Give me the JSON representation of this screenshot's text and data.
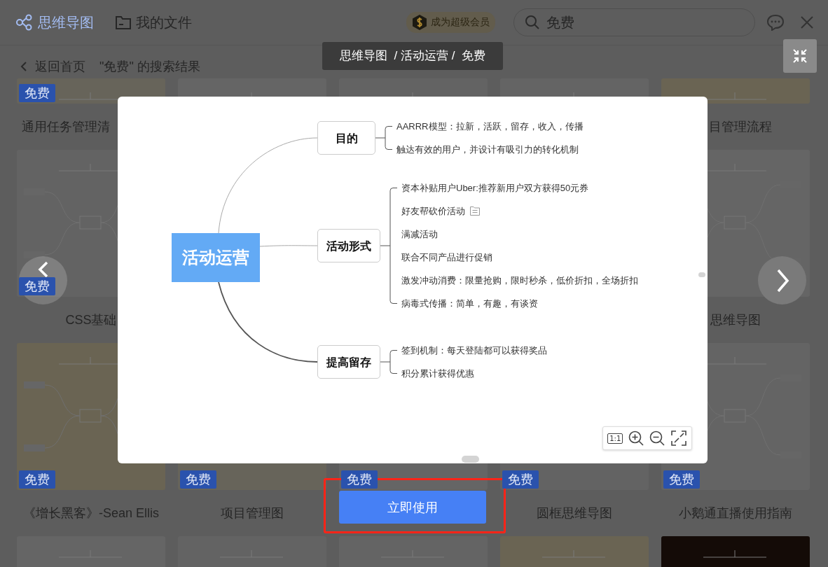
{
  "header": {
    "nav": [
      {
        "label": "思维导图",
        "selected": true
      },
      {
        "label": "我的文件",
        "selected": false
      }
    ],
    "vip": "成为超级会员",
    "search": {
      "value": "免费"
    }
  },
  "back": {
    "label": "返回首页",
    "results": "\"免费\" 的搜索结果"
  },
  "cards": [
    {
      "kind": "picture",
      "badge": "免费",
      "title": "通用任务管理清"
    },
    {
      "kind": "picture"
    },
    {
      "kind": "picture"
    },
    {
      "kind": "picture"
    },
    {
      "kind": "picture",
      "title": "目管理流程"
    },
    {
      "kind": "picture",
      "badge": "免费",
      "title": "CSS基础"
    },
    {
      "kind": "covered"
    },
    {
      "kind": "covered"
    },
    {
      "kind": "covered"
    },
    {
      "kind": "picture",
      "title": "思维导图"
    },
    {
      "kind": "picture",
      "badge": "免费",
      "title": "《增长黑客》-Sean Ellis"
    },
    {
      "kind": "picture",
      "badge": "免费",
      "title": "项目管理图"
    },
    {
      "kind": "picture",
      "badge": "免费"
    },
    {
      "kind": "picture",
      "badge": "免费",
      "title": "圆框思维导图"
    },
    {
      "kind": "picture",
      "badge": "免费",
      "title": "小鹅通直播使用指南"
    },
    {
      "kind": "picture"
    },
    {
      "kind": "picture"
    },
    {
      "kind": "picture"
    },
    {
      "kind": "picture"
    },
    {
      "kind": "picture"
    }
  ],
  "preview": {
    "breadcrumb": "思维导图  / 活动运营 /  免费",
    "mindmap": {
      "root": "活动运营",
      "branches": [
        {
          "label": "目的",
          "children": [
            {
              "label": "AARRR模型：拉新，活跃，留存，收入，传播",
              "note": false
            },
            {
              "label": "触达有效的用户，并设计有吸引力的转化机制",
              "note": false
            }
          ]
        },
        {
          "label": "活动形式",
          "children": [
            {
              "label": "资本补贴用户Uber:推荐新用户双方获得50元券",
              "note": false
            },
            {
              "label": "好友帮砍价活动",
              "note": true
            },
            {
              "label": "满减活动",
              "note": false
            },
            {
              "label": "联合不同产品进行促销",
              "note": false
            },
            {
              "label": "激发冲动消费：限量抢购，限时秒杀，低价折扣，全场折扣",
              "note": false
            },
            {
              "label": "病毒式传播：简单，有趣，有谈资",
              "note": false
            }
          ]
        },
        {
          "label": "提高留存",
          "children": [
            {
              "label": "签到机制：每天登陆都可以获得奖品",
              "note": false
            },
            {
              "label": "积分累计获得优惠",
              "note": false
            }
          ]
        }
      ]
    },
    "zoom_tools": {
      "ratio": "1:1"
    },
    "use_button": {
      "label": "立即使用",
      "highlighted": true
    }
  }
}
